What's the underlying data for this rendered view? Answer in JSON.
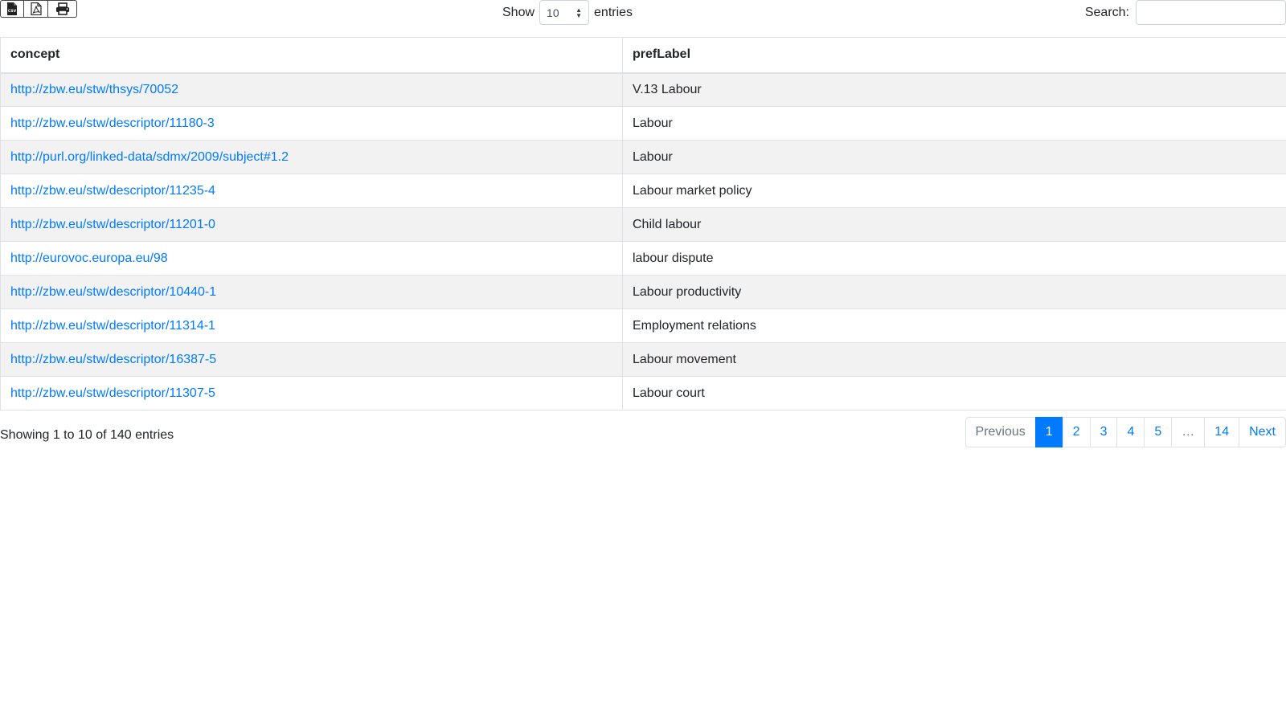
{
  "toolbar": {
    "buttons": [
      {
        "icon": "csv-file-icon",
        "label": "CSV"
      },
      {
        "icon": "pdf-file-icon"
      },
      {
        "icon": "print-icon"
      }
    ]
  },
  "length_menu": {
    "prefix": "Show",
    "value": "10",
    "suffix": "entries"
  },
  "search": {
    "label": "Search:",
    "value": ""
  },
  "table": {
    "columns": [
      "concept",
      "prefLabel"
    ],
    "rows": [
      {
        "concept": "http://zbw.eu/stw/thsys/70052",
        "prefLabel": "V.13 Labour"
      },
      {
        "concept": "http://zbw.eu/stw/descriptor/11180-3",
        "prefLabel": "Labour"
      },
      {
        "concept": "http://purl.org/linked-data/sdmx/2009/subject#1.2",
        "prefLabel": "Labour"
      },
      {
        "concept": "http://zbw.eu/stw/descriptor/11235-4",
        "prefLabel": "Labour market policy"
      },
      {
        "concept": "http://zbw.eu/stw/descriptor/11201-0",
        "prefLabel": "Child labour"
      },
      {
        "concept": "http://eurovoc.europa.eu/98",
        "prefLabel": "labour dispute"
      },
      {
        "concept": "http://zbw.eu/stw/descriptor/10440-1",
        "prefLabel": "Labour productivity"
      },
      {
        "concept": "http://zbw.eu/stw/descriptor/11314-1",
        "prefLabel": "Employment relations"
      },
      {
        "concept": "http://zbw.eu/stw/descriptor/16387-5",
        "prefLabel": "Labour movement"
      },
      {
        "concept": "http://zbw.eu/stw/descriptor/11307-5",
        "prefLabel": "Labour court"
      }
    ]
  },
  "footer": {
    "info": "Showing 1 to 10 of 140 entries",
    "pagination": {
      "previous": "Previous",
      "pages": [
        "1",
        "2",
        "3",
        "4",
        "5",
        "…",
        "14"
      ],
      "active": "1",
      "next": "Next"
    }
  },
  "colors": {
    "accent": "#007bff",
    "stripe": "#f2f2f2",
    "border": "#dee2e6"
  }
}
